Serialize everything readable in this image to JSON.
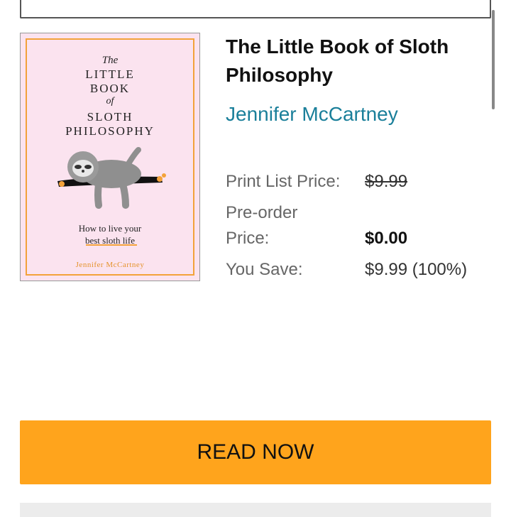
{
  "book": {
    "cover": {
      "the": "The",
      "title_lines": [
        "LITTLE",
        "BOOK"
      ],
      "of": "of",
      "sloth_lines": [
        "SLOTH",
        "PHILOSOPHY"
      ],
      "subtitle_lines": [
        "How to live your",
        "best sloth life"
      ],
      "author": "Jennifer McCartney",
      "background_color": "#fbe3ef",
      "accent_color": "#f3a23a"
    },
    "title": "The Little Book of Sloth Philosophy",
    "author": "Jennifer McCartney"
  },
  "pricing": {
    "print_list_label": "Print List Price:",
    "print_list_value": "$9.99",
    "preorder_label": "Pre-order Price:",
    "preorder_value": "$0.00",
    "you_save_label": "You Save:",
    "you_save_value": "$9.99 (100%)"
  },
  "actions": {
    "read_now_label": "READ NOW",
    "read_now_color": "#ffa41c"
  }
}
